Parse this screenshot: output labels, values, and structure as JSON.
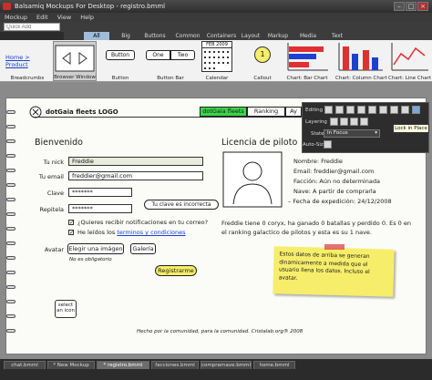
{
  "window": {
    "title": "Balsamiq Mockups For Desktop - registro.bmml"
  },
  "menu": {
    "items": [
      "Mockup",
      "Edit",
      "View",
      "Help"
    ]
  },
  "library": {
    "quick_add_placeholder": "Quick Add",
    "category_tabs": [
      "All",
      "Big",
      "Buttons",
      "Common",
      "Containers",
      "Layout",
      "Markup",
      "Media",
      "Text"
    ],
    "items": {
      "breadcrumbs": {
        "label": "Breadcrumbs",
        "home": "Home",
        "product": "Product"
      },
      "browser": {
        "label": "Browser Window"
      },
      "button": {
        "label": "Button",
        "text": "Button"
      },
      "buttonbar": {
        "label": "Button Bar",
        "one": "One",
        "two": "Two"
      },
      "calendar": {
        "label": "Calendar",
        "month": "FEB 2009"
      },
      "callout": {
        "label": "Callout",
        "number": "1"
      },
      "chart_bar": {
        "label": "Chart: Bar Chart"
      },
      "chart_column": {
        "label": "Chart: Column Chart"
      },
      "chart_line": {
        "label": "Chart: Line Chart"
      }
    }
  },
  "mockup": {
    "logo": "dotGaia fleets LOGO",
    "nav_tabs": [
      "dotGaia fleets",
      "Ranking",
      "Ay"
    ],
    "welcome": "Bienvenido",
    "form": {
      "nick_label": "Tu nick",
      "nick_value": "Freddie",
      "email_label": "Tu email",
      "email_value": "freddier@gmail.com",
      "password_label": "Clave",
      "password_value": "*******",
      "repeat_label": "Repitela",
      "repeat_value": "*******",
      "tooltip": "Tu clave es incorrecta",
      "notify_label": "¿Quieres recibir notificaciones en tu correo?",
      "terms_prefix": "He leídos los",
      "terms_link": "terminos y condiciones",
      "avatar_label": "Avatar",
      "choose_image": "Elegir una imágen",
      "gallery": "Galería",
      "optional_note": "No es obligatorio",
      "register": "Registrarme",
      "select_icon": "select an icon"
    },
    "license": {
      "title": "Licencia de piloto",
      "name": "Nombre: Freddie",
      "email": "Email: freddier@gmail.com",
      "faction": "Facción: Aún no determinada",
      "ship": "Nave: A partir de comprarla",
      "date": "Fecha de expedición: 24/12/2008",
      "summary": "Freddie tiene 0 coryx, ha ganado 0 batallas y perdido 0. Es 0 en el ranking galactico de pilotos y esta es su 1 nave."
    },
    "sticky_note": "Estos datos de arriba se generan dinamicamente a medida que el usuario llena los datos. Incluso el avatar.",
    "footer": "Hecho por la comunidad, para la comunidad. Cristalab.org® 2008"
  },
  "properties": {
    "editing_label": "Editing",
    "layering_label": "Layering",
    "state_label": "State",
    "state_value": "In Focus",
    "autosize_label": "Auto-Size",
    "lock_tooltip": "Lock in Place"
  },
  "doc_tabs": [
    "chat.bmml",
    "* New Mockup",
    "* registro.bmml",
    "facciones.bmml",
    "comprarnave.bmml",
    "home.bmml"
  ],
  "colors": {
    "accent_green": "#3dd44a",
    "sticky": "#f6ee6a",
    "sticky_tape": "#e05050",
    "chart_red": "#e03030",
    "chart_blue": "#2040d0",
    "tab_active": "#9fbcd8"
  }
}
